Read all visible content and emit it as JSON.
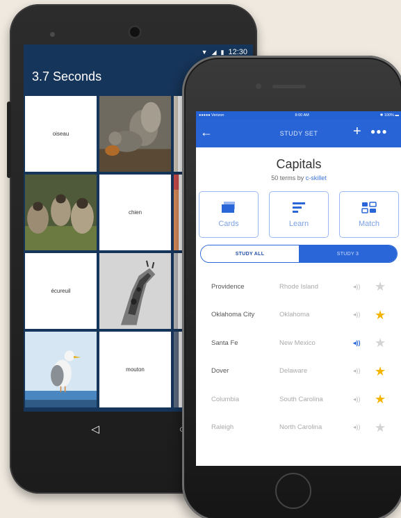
{
  "android": {
    "status_time": "12:30",
    "title": "3.7 Seconds",
    "tiles": [
      {
        "type": "word",
        "label": "oiseau"
      },
      {
        "type": "image",
        "image": "squirrel"
      },
      {
        "type": "image",
        "image": "partial"
      },
      {
        "type": "image",
        "image": "sheep"
      },
      {
        "type": "word",
        "label": "chien"
      },
      {
        "type": "image",
        "image": "partial"
      },
      {
        "type": "word",
        "label": "écureuil"
      },
      {
        "type": "image",
        "image": "giraffe"
      },
      {
        "type": "image",
        "image": "partial"
      },
      {
        "type": "image",
        "image": "seagull"
      },
      {
        "type": "word",
        "label": "mouton"
      },
      {
        "type": "image",
        "image": "partial"
      }
    ],
    "nav": {
      "back_glyph": "◁",
      "home_glyph": "○"
    }
  },
  "ios": {
    "status_carrier": "●●●●● Verizon",
    "status_time": "8:00 AM",
    "status_battery": "100%",
    "nav_title": "STUDY SET",
    "set_title": "Capitals",
    "set_sub_prefix": "50 terms by",
    "set_author": "c-skillet",
    "modes": [
      {
        "label": "Cards",
        "icon": "cards-icon"
      },
      {
        "label": "Learn",
        "icon": "learn-icon"
      },
      {
        "label": "Match",
        "icon": "match-icon"
      }
    ],
    "toggle": {
      "all": "STUDY ALL",
      "three": "STUDY 3"
    },
    "terms": [
      {
        "word": "Providence",
        "definition": "Rhode Island",
        "starred": false,
        "speaking": false
      },
      {
        "word": "Oklahoma City",
        "definition": "Oklahoma",
        "starred": true,
        "speaking": false
      },
      {
        "word": "Santa Fe",
        "definition": "New Mexico",
        "starred": false,
        "speaking": true
      },
      {
        "word": "Dover",
        "definition": "Delaware",
        "starred": true,
        "speaking": false
      },
      {
        "word": "Columbia",
        "definition": "South Carolina",
        "starred": true,
        "speaking": false
      },
      {
        "word": "Raleigh",
        "definition": "North Carolina",
        "starred": false,
        "speaking": false
      }
    ],
    "colors": {
      "brand": "#2864d6",
      "star_on": "#f4b400"
    }
  }
}
